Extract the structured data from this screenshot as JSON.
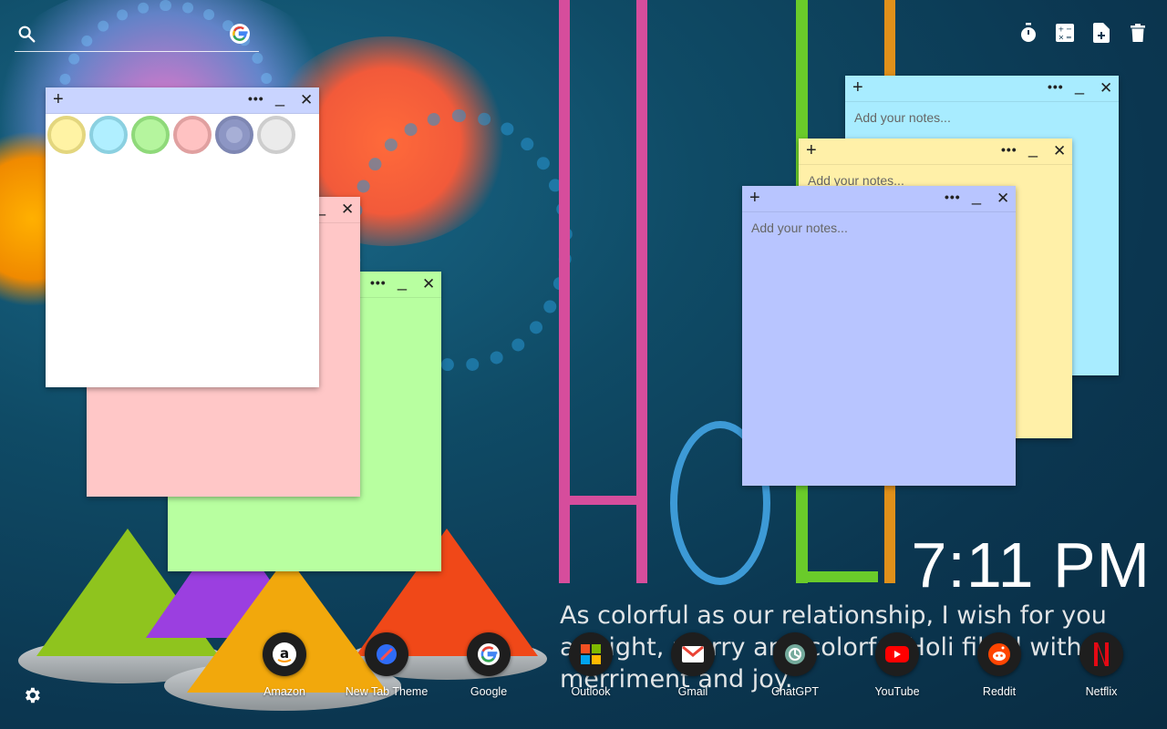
{
  "search": {
    "placeholder": "",
    "engine": "Google"
  },
  "toolbar": [
    "timer-icon",
    "calculator-icon",
    "new-note-icon",
    "trash-icon"
  ],
  "notes": [
    {
      "id": "white",
      "color": "#ffffff",
      "header_color": "#c9d4ff",
      "placeholder": "",
      "has_palette": true
    },
    {
      "id": "pink",
      "color": "#ffc7c7",
      "placeholder": ""
    },
    {
      "id": "green",
      "color": "#b8ffa0",
      "placeholder": ""
    },
    {
      "id": "cyan",
      "color": "#a8ecff",
      "placeholder": "Add your notes..."
    },
    {
      "id": "yellow",
      "color": "#fff0a8",
      "placeholder": "Add your notes..."
    },
    {
      "id": "blue",
      "color": "#b8c5ff",
      "placeholder": "Add your notes..."
    }
  ],
  "note_controls": {
    "add": "+",
    "more": "•••",
    "minimize": "_",
    "close": "✕"
  },
  "palette": [
    {
      "name": "yellow",
      "fill": "#fff3a4",
      "ring": "#e3d67e"
    },
    {
      "name": "cyan",
      "fill": "#b0efff",
      "ring": "#8bd0e0"
    },
    {
      "name": "green",
      "fill": "#b5f59e",
      "ring": "#8fd97a"
    },
    {
      "name": "pink",
      "fill": "#ffc2c2",
      "ring": "#e0a0a0"
    },
    {
      "name": "blue",
      "fill": "#a7afd6",
      "ring": "#7e87b3",
      "selected": true
    },
    {
      "name": "white",
      "fill": "#ebebeb",
      "ring": "#cdcdcd"
    }
  ],
  "clock": {
    "time": "7:11 PM"
  },
  "quote": {
    "text": "As colorful as our relationship, I wish for you a bright, merry and colorful Holi filled with merriment and joy."
  },
  "shortcuts": [
    {
      "label": "Amazon",
      "icon": "amazon-icon"
    },
    {
      "label": "New Tab Theme",
      "icon": "new-tab-theme-icon"
    },
    {
      "label": "Google",
      "icon": "google-icon"
    },
    {
      "label": "Outlook",
      "icon": "outlook-icon"
    },
    {
      "label": "Gmail",
      "icon": "gmail-icon"
    },
    {
      "label": "ChatGPT",
      "icon": "chatgpt-icon"
    },
    {
      "label": "YouTube",
      "icon": "youtube-icon"
    },
    {
      "label": "Reddit",
      "icon": "reddit-icon"
    },
    {
      "label": "Netflix",
      "icon": "netflix-icon"
    }
  ],
  "colors": {
    "accent_text": "#ffffff",
    "background": "#0b3650"
  }
}
